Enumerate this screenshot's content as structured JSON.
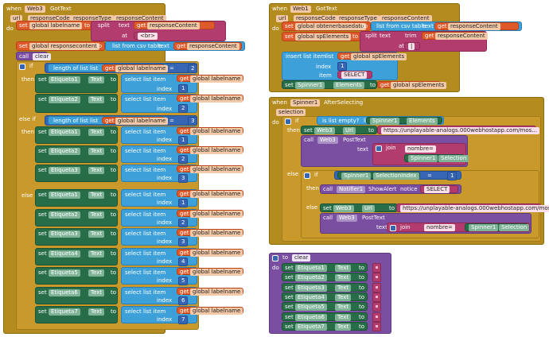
{
  "left_event": {
    "when": "when",
    "component": "Web3",
    "event": "GotText",
    "do": "do",
    "params": [
      "url",
      "responseCode",
      "responseType",
      "responseContent"
    ]
  },
  "right_event": {
    "when": "when",
    "component": "Web1",
    "event": "GotText",
    "do": "do",
    "params": [
      "url",
      "responseCode",
      "responseType",
      "responseContent"
    ]
  },
  "spinner_event": {
    "when": "when",
    "component": "Spinner1",
    "event": "AfterSelecting",
    "param": "selection",
    "do": "do"
  },
  "clear_proc": {
    "to": "to",
    "name": "clear",
    "do": "do"
  },
  "words": {
    "set": "set",
    "to": "to",
    "get": "get",
    "call": "call",
    "if": "if",
    "then": "then",
    "else": "else",
    "else_if": "else if",
    "index": "index",
    "item": "item",
    "text": "text",
    "at": "at",
    "split": "split",
    "trim": "trim",
    "join": "join",
    "notice": "notice",
    "list_from_csv": "list from csv table",
    "length_of_list": "length of list",
    "list": "list",
    "select_list_item": "select list item",
    "insert_list_item": "insert list item",
    "is_list_empty": "is list empty?",
    "eq": "=",
    "text_prop": "Text",
    "dd": "▾"
  },
  "vars": {
    "labelname": "global labelname",
    "responsecontent": "global responsecontent",
    "obtenerbasedato": "global obtenerbasedato",
    "spelements": "global spElements",
    "responseContent": "responseContent"
  },
  "literals": {
    "br": "<br>",
    "select": "SELECT",
    "nombre": "nombre=",
    "url": "https://unplayable-analogs.000webhostapp.com/mos...",
    "url2": "https://unplayable-analogs.000webhostapp.com/mos...",
    "sep": "|",
    "n1": "1",
    "n2": "2",
    "n3": "3",
    "n4": "4",
    "n5": "5",
    "n6": "6",
    "n7": "7"
  },
  "components": {
    "e1": "Etiqueta1",
    "e2": "Etiqueta2",
    "e3": "Etiqueta3",
    "e4": "Etiqueta4",
    "e5": "Etiqueta5",
    "e6": "Etiqueta6",
    "e7": "Etiqueta7",
    "sp": "Spinner1",
    "web3": "Web3",
    "notifier": "Notifier1",
    "elements": "Elements",
    "selection": "Selection",
    "selidx": "SelectionIndex",
    "url_prop": "Url",
    "posttext": "PostText",
    "showalert": "ShowAlert",
    "clear": "clear"
  }
}
